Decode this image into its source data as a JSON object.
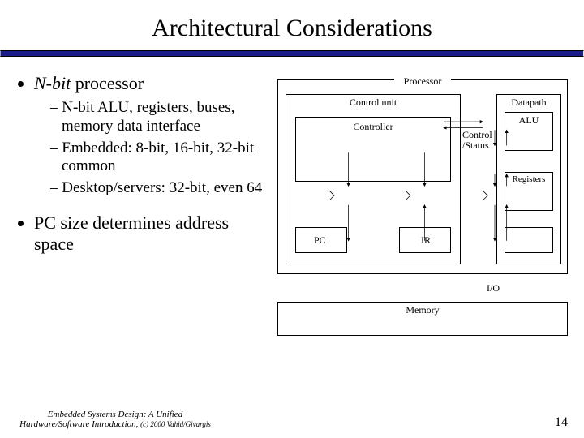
{
  "title": "Architectural Considerations",
  "bullets": {
    "b1_main": "N-bit",
    "b1_rest": " processor",
    "b1_sub1": "N-bit ALU, registers, buses, memory data interface",
    "b1_sub2": "Embedded: 8-bit, 16-bit, 32-bit common",
    "b1_sub3": "Desktop/servers: 32-bit, even 64",
    "b2": "PC size determines address space"
  },
  "diagram": {
    "processor": "Processor",
    "control_unit": "Control unit",
    "datapath": "Datapath",
    "controller": "Controller",
    "alu": "ALU",
    "registers": "Registers",
    "control_status": "Control /Status",
    "pc": "PC",
    "ir": "IR",
    "io": "I/O",
    "memory": "Memory"
  },
  "footer": {
    "line1": "Embedded Systems Design: A Unified",
    "line2_a": "Hardware/Software Introduction, ",
    "line2_b": "(c) 2000 Vahid/Givargis"
  },
  "page": "14"
}
